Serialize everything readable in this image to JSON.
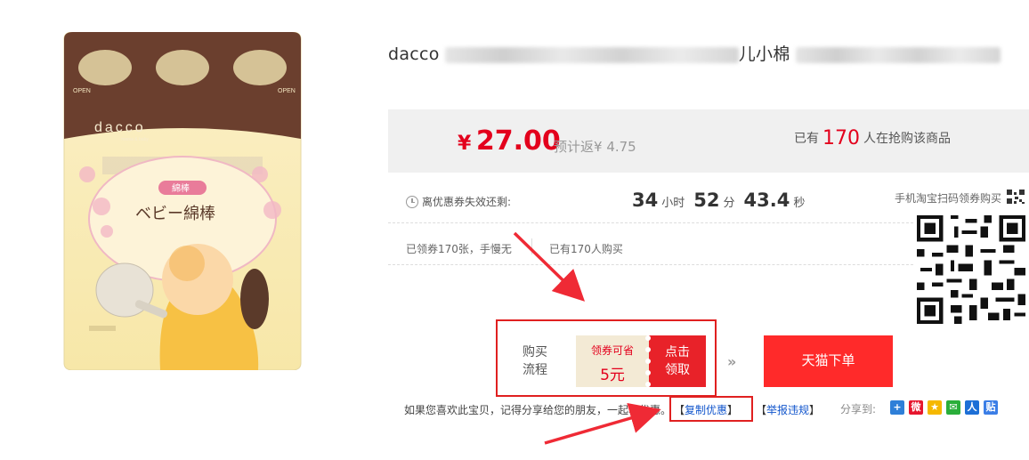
{
  "product": {
    "title_visible": "dacco",
    "title_visible_2": "儿小棉",
    "image_brand": "dacco",
    "image_brand_sub": "mama & baby",
    "image_tag": "綿棒",
    "image_label": "ベビー綿棒",
    "image_open_left": "OPEN",
    "image_open_right": "OPEN"
  },
  "price": {
    "symbol": "¥",
    "value": "27.00",
    "rebate_label": "预计返¥",
    "rebate_value": "4.75"
  },
  "buyers": {
    "prefix": "已有",
    "count": "170",
    "suffix": "人在抢购该商品"
  },
  "countdown": {
    "label": "离优惠券失效还剩:",
    "hours": "34",
    "hours_unit": "小时",
    "minutes": "52",
    "minutes_unit": "分",
    "seconds": "43.4",
    "seconds_unit": "秒"
  },
  "scan": {
    "text": "手机淘宝扫码领券购买"
  },
  "stats": {
    "claimed": "已领券170张，手慢无",
    "bought": "已有170人购买"
  },
  "flow": {
    "label_line1": "购买",
    "label_line2": "流程",
    "coupon_line1": "领券可省",
    "coupon_line2": "5元",
    "claim_line1": "点击",
    "claim_line2": "领取",
    "chevrons": "»"
  },
  "order_button": "天猫下单",
  "share": {
    "text": "如果您喜欢此宝贝，记得分享给您的朋友，一起享优惠。",
    "copy_open": "【",
    "copy_label": "复制优惠",
    "copy_close": "】",
    "report_open": "【",
    "report_label": "举报违规",
    "report_close": "】",
    "share_to": "分享到:",
    "icons": [
      {
        "name": "qzone-icon",
        "glyph": "+",
        "color": "#2e7fd8"
      },
      {
        "name": "weibo-icon",
        "glyph": "微",
        "color": "#e6162d"
      },
      {
        "name": "qq-icon",
        "glyph": "★",
        "color": "#f5b800"
      },
      {
        "name": "wechat-icon",
        "glyph": "✉",
        "color": "#2aae3a"
      },
      {
        "name": "renren-icon",
        "glyph": "人",
        "color": "#1d6fd6"
      },
      {
        "name": "baidu-icon",
        "glyph": "贴",
        "color": "#3b7ee6"
      }
    ]
  },
  "colors": {
    "accent_red": "#e3001c",
    "button_red": "#ff2a2a",
    "link_blue": "#1155cc"
  }
}
